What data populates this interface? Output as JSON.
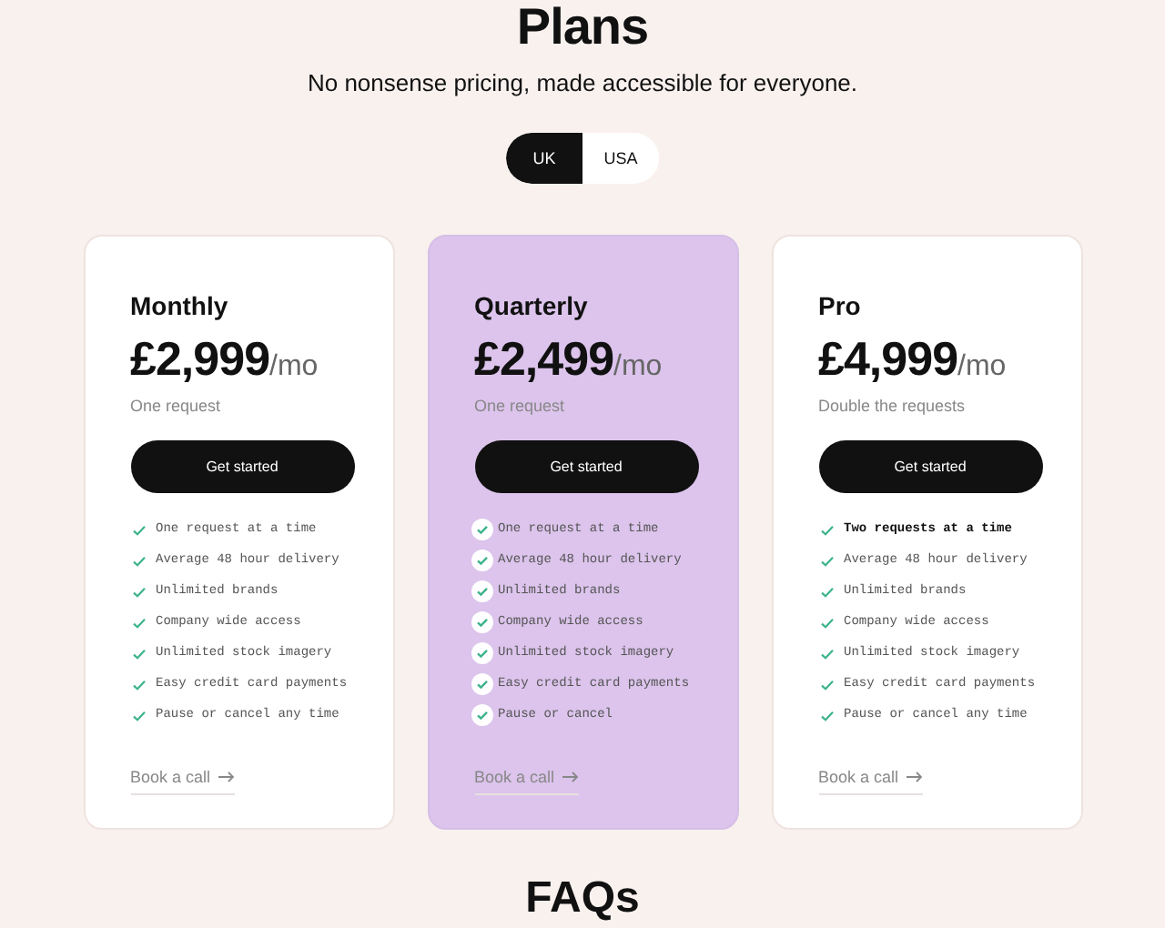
{
  "heading": "Plans",
  "subtitle": "No nonsense pricing, made accessible for everyone.",
  "region_toggle": [
    {
      "label": "UK",
      "selected": true
    },
    {
      "label": "USA",
      "selected": false
    }
  ],
  "plans": [
    {
      "name": "Monthly",
      "price": "£2,999",
      "period": "/mo",
      "note": "One request",
      "featured": false,
      "button": "Get started",
      "link": "Book a call",
      "features": [
        {
          "text": "One request at a time",
          "bold": false
        },
        {
          "text": "Average 48 hour delivery",
          "bold": false
        },
        {
          "text": "Unlimited brands",
          "bold": false
        },
        {
          "text": "Company wide access",
          "bold": false
        },
        {
          "text": "Unlimited stock imagery",
          "bold": false
        },
        {
          "text": "Easy credit card payments",
          "bold": false
        },
        {
          "text": "Pause or cancel any time",
          "bold": false
        }
      ]
    },
    {
      "name": "Quarterly",
      "price": "£2,499",
      "period": "/mo",
      "note": "One request",
      "featured": true,
      "button": "Get started",
      "link": "Book a call",
      "features": [
        {
          "text": "One request at a time",
          "bold": false
        },
        {
          "text": "Average 48 hour delivery",
          "bold": false
        },
        {
          "text": "Unlimited brands",
          "bold": false
        },
        {
          "text": "Company wide access",
          "bold": false
        },
        {
          "text": "Unlimited stock imagery",
          "bold": false
        },
        {
          "text": "Easy credit card payments",
          "bold": false
        },
        {
          "text": "Pause or cancel",
          "bold": false
        }
      ]
    },
    {
      "name": "Pro",
      "price": "£4,999",
      "period": "/mo",
      "note": "Double the requests",
      "featured": false,
      "button": "Get started",
      "link": "Book a call",
      "features": [
        {
          "text": "Two requests at a time",
          "bold": true
        },
        {
          "text": "Average 48 hour delivery",
          "bold": false
        },
        {
          "text": "Unlimited brands",
          "bold": false
        },
        {
          "text": "Company wide access",
          "bold": false
        },
        {
          "text": "Unlimited stock imagery",
          "bold": false
        },
        {
          "text": "Easy credit card payments",
          "bold": false
        },
        {
          "text": "Pause or cancel any time",
          "bold": false
        }
      ]
    }
  ],
  "next_heading": "FAQs"
}
